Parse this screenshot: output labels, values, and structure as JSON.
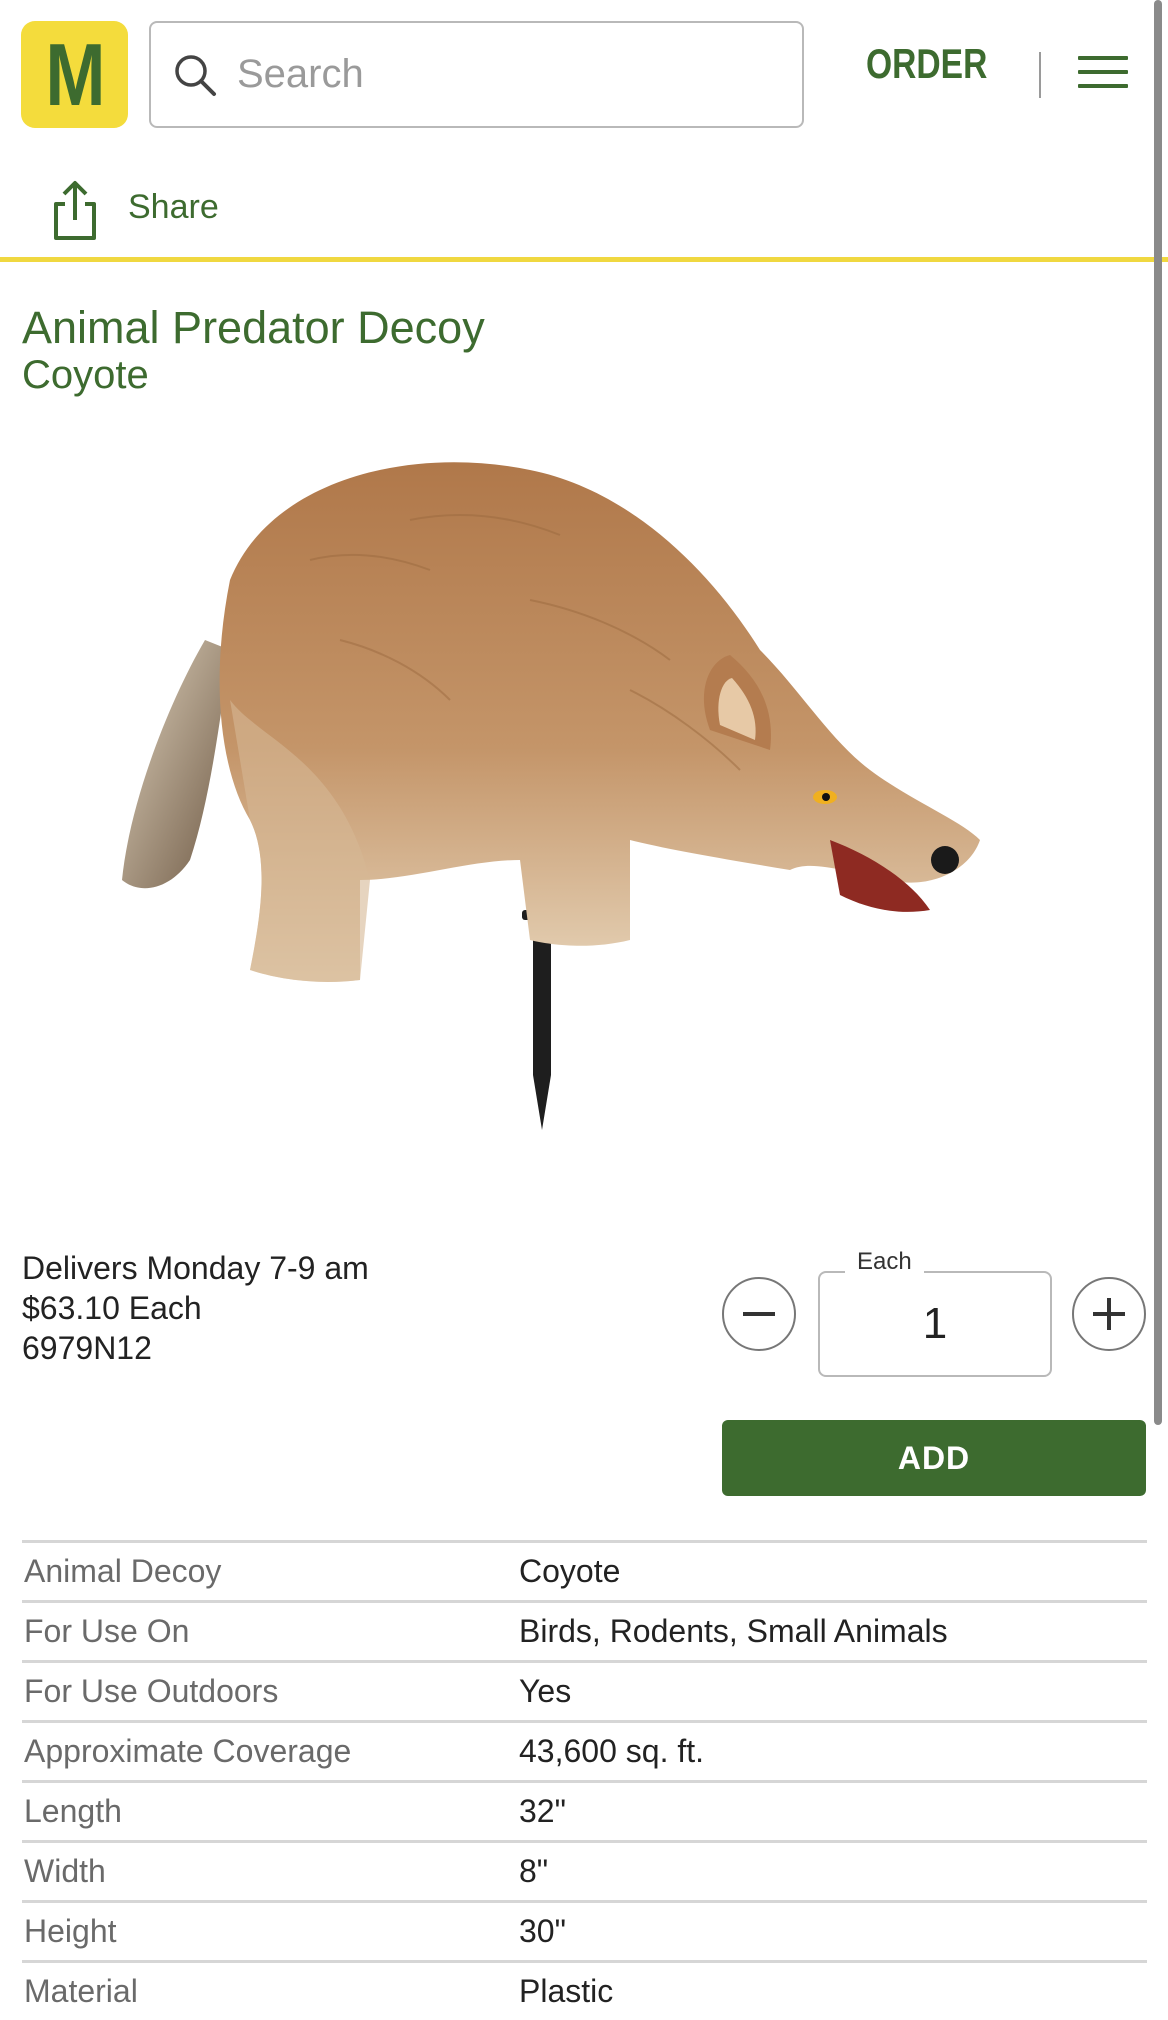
{
  "header": {
    "logo_letter": "M",
    "search_placeholder": "Search",
    "order_label": "ORDER",
    "share_label": "Share"
  },
  "product": {
    "title": "Animal Predator Decoy",
    "subtitle": "Coyote",
    "delivery": "Delivers Monday 7-9 am",
    "price": "$63.10 Each",
    "part_number": "6979N12"
  },
  "quantity": {
    "unit_label": "Each",
    "value": "1"
  },
  "add_label": "ADD",
  "specs": [
    {
      "label": "Animal Decoy",
      "value": "Coyote"
    },
    {
      "label": "For Use On",
      "value": "Birds, Rodents, Small Animals"
    },
    {
      "label": "For Use Outdoors",
      "value": "Yes"
    },
    {
      "label": "Approximate Coverage",
      "value": "43,600 sq. ft."
    },
    {
      "label": "Length",
      "value": "32\""
    },
    {
      "label": "Width",
      "value": "8\""
    },
    {
      "label": "Height",
      "value": "30\""
    },
    {
      "label": "Material",
      "value": "Plastic"
    }
  ],
  "colors": {
    "brand_green": "#3d6b2f",
    "brand_yellow": "#f4dc3c"
  }
}
